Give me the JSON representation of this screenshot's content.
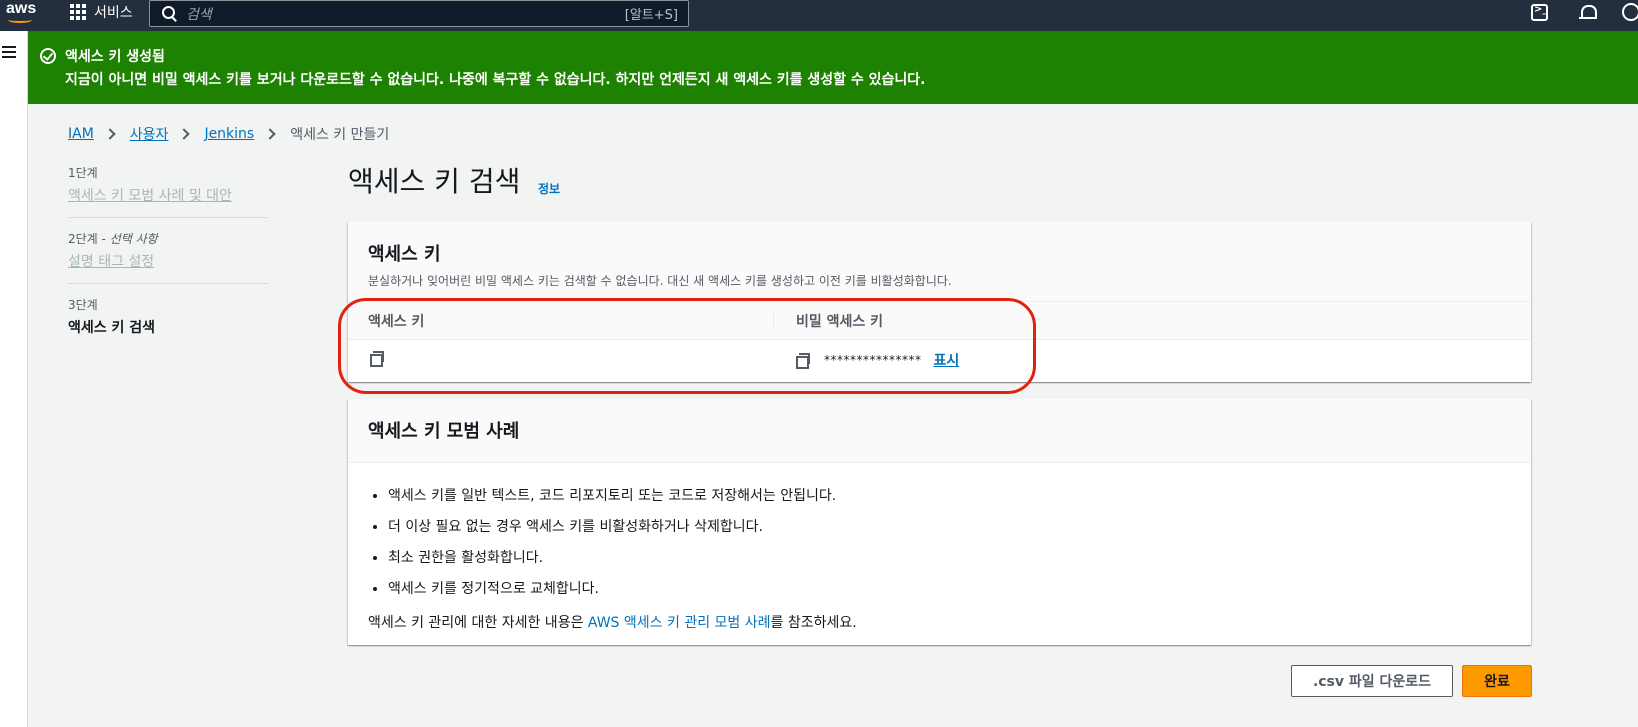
{
  "topbar": {
    "logo_text": "aws",
    "services_label": "서비스",
    "search_placeholder": "검색",
    "search_shortcut": "[알트+S]"
  },
  "flash": {
    "title": "액세스 키 생성됨",
    "message": "지금이 아니면 비밀 액세스 키를 보거나 다운로드할 수 없습니다. 나중에 복구할 수 없습니다. 하지만 언제든지 새 액세스 키를 생성할 수 있습니다."
  },
  "breadcrumb": {
    "items": [
      "IAM",
      "사용자",
      "Jenkins"
    ],
    "current": "액세스 키 만들기"
  },
  "steps": [
    {
      "num": "1단계",
      "label": "액세스 키 모범 사례 및 대안"
    },
    {
      "num": "2단계",
      "optional": "선택 사항",
      "label": "설명 태그 설정"
    },
    {
      "num": "3단계",
      "label": "액세스 키 검색"
    }
  ],
  "page": {
    "title": "액세스 키 검색",
    "info_link": "정보"
  },
  "keys_panel": {
    "title": "액세스 키",
    "description": "분실하거나 잊어버린 비밀 액세스 키는 검색할 수 없습니다. 대신 새 액세스 키를 생성하고 이전 키를 비활성화합니다.",
    "col_access": "액세스 키",
    "col_secret": "비밀 액세스 키",
    "secret_masked": "***************",
    "show_label": "표시"
  },
  "best_practices": {
    "title": "액세스 키 모범 사례",
    "items": [
      "액세스 키를 일반 텍스트, 코드 리포지토리 또는 코드로 저장해서는 안됩니다.",
      "더 이상 필요 없는 경우 액세스 키를 비활성화하거나 삭제합니다.",
      "최소 권한을 활성화합니다.",
      "액세스 키를 정기적으로 교체합니다."
    ],
    "more_prefix": "액세스 키 관리에 대한 자세한 내용은 ",
    "more_link": "AWS 액세스 키 관리 모범 사례",
    "more_suffix": "를 참조하세요."
  },
  "actions": {
    "csv_label": ".csv 파일 다운로드",
    "done_label": "완료"
  },
  "colors": {
    "flash_bg": "#1d8102",
    "topbar_bg": "#232f3e",
    "link": "#0073bb",
    "primary_btn": "#ff9900",
    "highlight": "#e0220f"
  }
}
